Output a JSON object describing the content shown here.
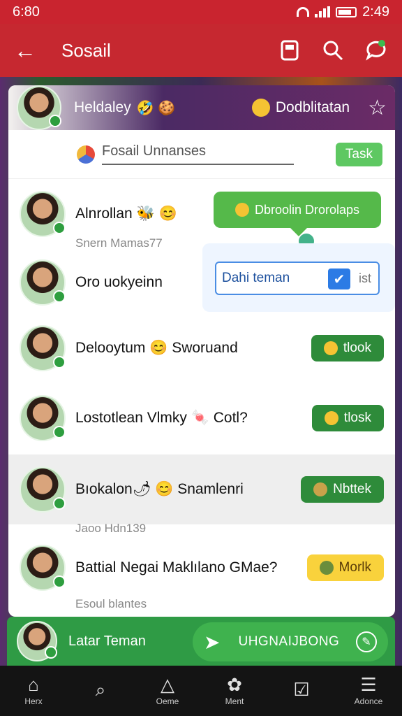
{
  "status_bar": {
    "time": "6:80",
    "clock_right": "2:49"
  },
  "app_bar": {
    "title": "Sosail",
    "back": "←"
  },
  "header": {
    "name": "Heldaley",
    "emoji": "🤣 🍪",
    "badge_text": "Dodblitatan",
    "star": "☆"
  },
  "search": {
    "label": "Fosail Unnanses",
    "task_button": "Task"
  },
  "popups": {
    "green_bubble": "Dbroolin Drorolaps",
    "input_text": "Dahi teman",
    "input_suffix": "ist",
    "check": "✔"
  },
  "rows": [
    {
      "name": "Alnrollan 🐝 😊",
      "sub": "Snern Mamas77",
      "button": ""
    },
    {
      "name": "Oro uokyeinn",
      "sub": "",
      "button": ""
    },
    {
      "name": "Delooytum 😊 Sworuand",
      "sub": "",
      "button": "tlook"
    },
    {
      "name": "Lostotlean Vlmky 🍬 Cotl?",
      "sub": "",
      "button": "tlosk"
    },
    {
      "name": "Bıokalon🌶 😊 Snamlenri",
      "sub": "Jaoo Hdn139",
      "button": "Nbttek"
    },
    {
      "name": "Battial Negai Maklılano GMae?",
      "sub": "Esoul blantes",
      "button": "Morlk"
    }
  ],
  "action_bar": {
    "label": "Latar Teman",
    "pill": "UHGNAIJBONG",
    "send": "➤",
    "edit": "✎"
  },
  "nav": [
    {
      "icon": "⌂",
      "label": "Herx"
    },
    {
      "icon": "⌕",
      "label": ""
    },
    {
      "icon": "△",
      "label": "Oeme"
    },
    {
      "icon": "✿",
      "label": "Ment"
    },
    {
      "icon": "☑",
      "label": ""
    },
    {
      "icon": "☰",
      "label": "Adonce"
    }
  ]
}
